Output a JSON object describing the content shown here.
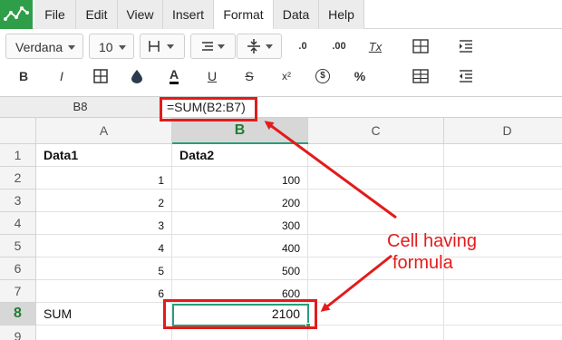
{
  "menu": {
    "tabs": [
      {
        "label": "File"
      },
      {
        "label": "Edit"
      },
      {
        "label": "View"
      },
      {
        "label": "Insert"
      },
      {
        "label": "Format"
      },
      {
        "label": "Data"
      },
      {
        "label": "Help"
      }
    ],
    "active": "Format"
  },
  "toolbar": {
    "font_family": "Verdana",
    "font_size": "10",
    "bold": "B",
    "italic": "I",
    "text_color": "A",
    "underline": "U",
    "strike": "S",
    "superscript": "x²",
    "currency": "$",
    "percent": "%",
    "clear_format": "Tx",
    "dec_decrease": ".0",
    "dec_increase": ".00"
  },
  "formula_bar": {
    "cell_ref": "B8",
    "formula": "=SUM(B2:B7)"
  },
  "grid": {
    "columns": [
      "A",
      "B",
      "C",
      "D"
    ],
    "rows": [
      "1",
      "2",
      "3",
      "4",
      "5",
      "6",
      "7",
      "8",
      "9"
    ],
    "selected_cell": "B8",
    "cells": {
      "A1": "Data1",
      "B1": "Data2",
      "A2": "1",
      "B2": "100",
      "A3": "2",
      "B3": "200",
      "A4": "3",
      "B4": "300",
      "A5": "4",
      "B5": "400",
      "A6": "5",
      "B6": "500",
      "A7": "6",
      "B7": "600",
      "A8": "SUM",
      "B8": "2100"
    }
  },
  "annotation": {
    "line1": "Cell having",
    "line2": "formula",
    "color": "#e31b1b"
  },
  "colors": {
    "accent": "#2a9d7a",
    "logo": "#2e9e48",
    "annotation_red": "#e31b1b"
  }
}
